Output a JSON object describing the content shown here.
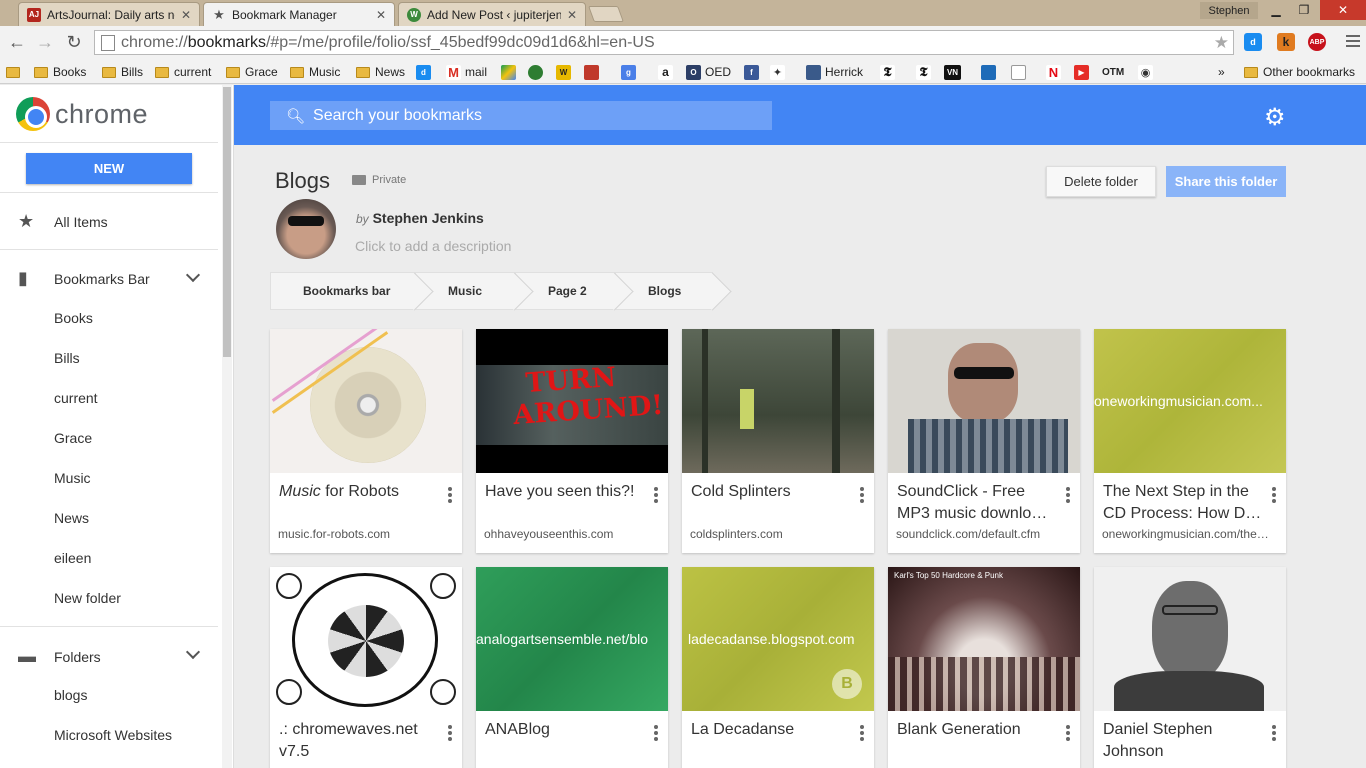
{
  "tabs": [
    {
      "title": "ArtsJournal: Daily arts new",
      "favicon": "AJ"
    },
    {
      "title": "Bookmark Manager",
      "favicon": "star-icon"
    },
    {
      "title": "Add New Post ‹ jupiterjen",
      "favicon": "wordpress-icon"
    }
  ],
  "window": {
    "profile": "Stephen"
  },
  "omnibox": {
    "scheme": "chrome://",
    "host": "bookmarks",
    "path": "/#p=/me/profile/folio/ssf_45bedf99dc09d1d6&hl=en-US"
  },
  "extensions": [
    "d",
    "k",
    "ABP"
  ],
  "bookmarks_bar": {
    "items": [
      "Books",
      "Bills",
      "current",
      "Grace",
      "Music",
      "News",
      "mail",
      "OED",
      "Herrick",
      "OTM"
    ],
    "overflow": "»",
    "other": "Other bookmarks"
  },
  "sidebar": {
    "logo": "chrome",
    "new_label": "NEW",
    "all_items": "All Items",
    "bookmarks_bar_label": "Bookmarks Bar",
    "bar_items": [
      "Books",
      "Bills",
      "current",
      "Grace",
      "Music",
      "News",
      "eileen",
      "New folder"
    ],
    "folders_label": "Folders",
    "folder_items": [
      "blogs",
      "Microsoft Websites"
    ]
  },
  "search": {
    "placeholder": "Search your bookmarks"
  },
  "folder": {
    "title": "Blogs",
    "privacy": "Private",
    "by": "by",
    "author": "Stephen Jenkins",
    "description_placeholder": "Click to add a description",
    "delete_label": "Delete folder",
    "share_label": "Share this folder"
  },
  "breadcrumbs": [
    "Bookmarks bar",
    "Music",
    "Page 2",
    "Blogs"
  ],
  "cards": [
    {
      "title_em": "Music",
      "title": " for Robots",
      "url": "music.for-robots.com",
      "thumb_text": ""
    },
    {
      "title_em": "",
      "title": "Have you seen this?!",
      "url": "ohhaveyouseenthis.com",
      "thumb_text": "TURN AROUND!"
    },
    {
      "title_em": "",
      "title": "Cold Splinters",
      "url": "coldsplinters.com",
      "thumb_text": ""
    },
    {
      "title_em": "",
      "title": "SoundClick - Free MP3 music downlo…",
      "url": "soundclick.com/default.cfm",
      "thumb_text": ""
    },
    {
      "title_em": "",
      "title": "The Next Step in the CD Process: How D…",
      "url": "oneworkingmusician.com/the…",
      "thumb_text": "oneworkingmusician.com..."
    },
    {
      "title_em": "",
      "title": ".: chromewaves.net v7.5",
      "url": "",
      "thumb_text": ""
    },
    {
      "title_em": "",
      "title": "ANABlog",
      "url": "",
      "thumb_text": "analogartsensemble.net/blo"
    },
    {
      "title_em": "",
      "title": "La Decadanse",
      "url": "",
      "thumb_text": "ladecadanse.blogspot.com"
    },
    {
      "title_em": "",
      "title": "Blank Generation",
      "url": "",
      "thumb_text": "Karl's Top 50 Hardcore & Punk"
    },
    {
      "title_em": "",
      "title": "Daniel Stephen Johnson",
      "url": "",
      "thumb_text": ""
    }
  ],
  "colors": {
    "accent": "#4285f4",
    "share": "#8ab4f8",
    "olive": "#b5bc3f",
    "green": "#2e9a58"
  }
}
